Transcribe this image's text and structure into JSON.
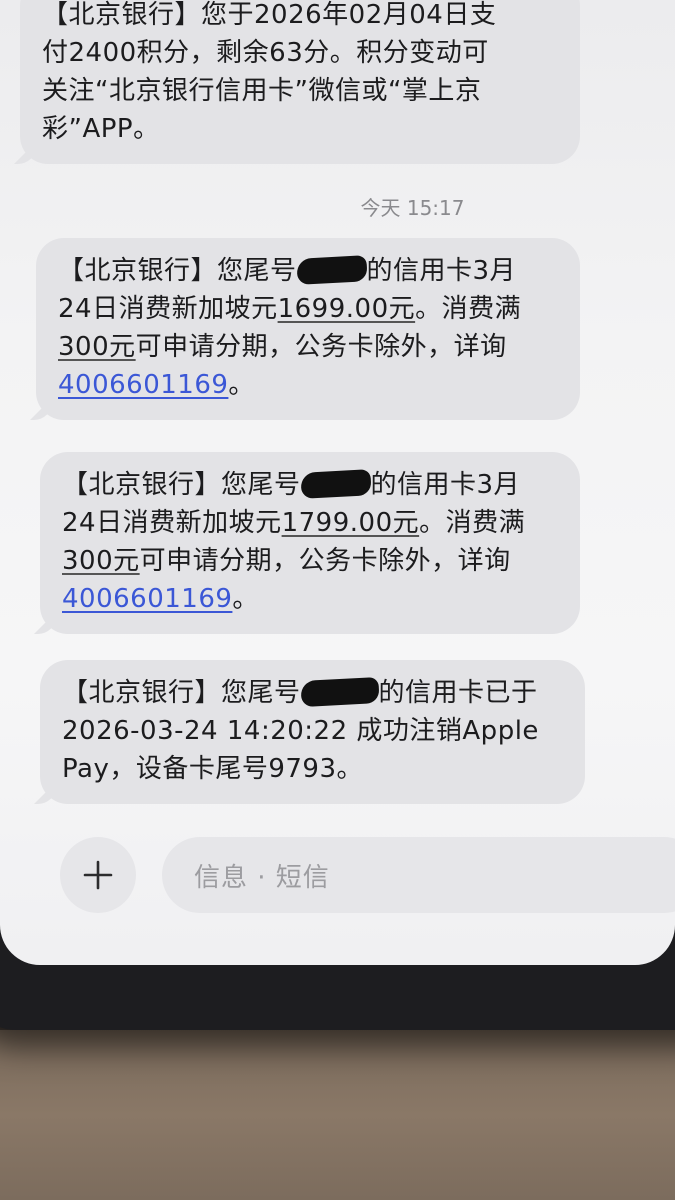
{
  "messages": [
    {
      "lines": [
        "【北京银行】您于2026年02月04日支",
        "付2400积分，剩余63分。积分变动可",
        "关注“北京银行信用卡”微信或“掌上京",
        "彩”APP。"
      ]
    },
    {
      "prefix": "【北京银行】您尾号",
      "suffix": "的信用卡3月",
      "line2_a": "24日消费新加坡元",
      "line2_amount": "1699.00元",
      "line2_b": "。消费满",
      "line3_amount": "300元",
      "line3_b": "可申请分期，公务卡除外，详询",
      "phone": "4006601169",
      "end": "。"
    },
    {
      "prefix": "【北京银行】您尾号",
      "suffix": "的信用卡3月",
      "line2_a": "24日消费新加坡元",
      "line2_amount": "1799.00元",
      "line2_b": "。消费满",
      "line3_amount": "300元",
      "line3_b": "可申请分期，公务卡除外，详询",
      "phone": "4006601169",
      "end": "。"
    },
    {
      "prefix": "【北京银行】您尾号",
      "suffix": "的信用卡已于",
      "line2": "2026-03-24 14:20:22 成功注销Apple",
      "line3": "Pay，设备卡尾号9793。"
    }
  ],
  "timestamp": "今天 15:17",
  "input": {
    "plus_symbol": "+",
    "placeholder": "信息 · 短信"
  },
  "colors": {
    "bubble": "#e3e3e6",
    "link": "#3b57d6",
    "background": "#f3f3f4"
  }
}
